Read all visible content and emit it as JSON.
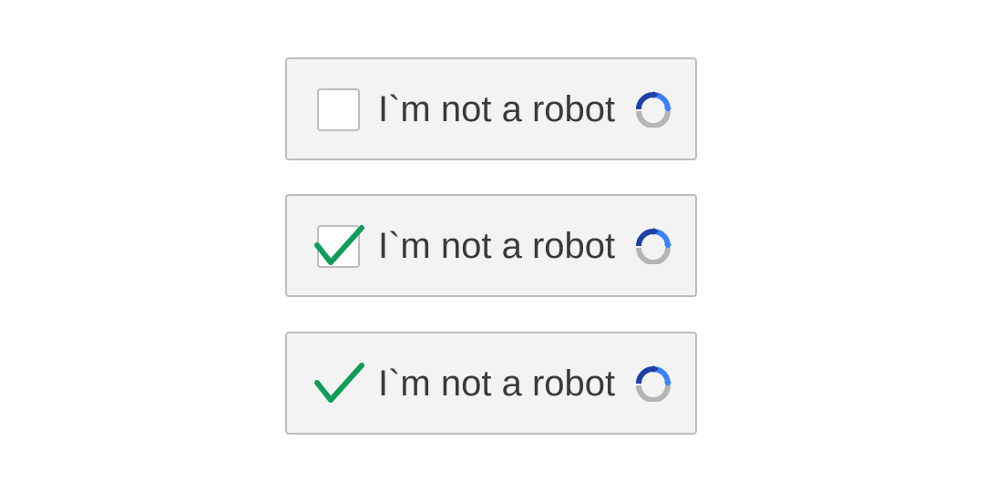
{
  "widgets": [
    {
      "state": "unchecked",
      "label": "I`m not a robot",
      "logo_icon": "captcha-logo-icon"
    },
    {
      "state": "checked",
      "label": "I`m not a robot",
      "logo_icon": "captcha-logo-icon"
    },
    {
      "state": "verified",
      "label": "I`m not a robot",
      "logo_icon": "captcha-logo-icon"
    }
  ],
  "colors": {
    "check": "#0f9d58",
    "logo_blue_dark": "#1e3fa8",
    "logo_blue_light": "#3b82f6",
    "logo_gray": "#b5b5b5",
    "widget_bg": "#f3f3f3",
    "widget_border": "#bdbdbd",
    "text": "#3a3a3a"
  }
}
